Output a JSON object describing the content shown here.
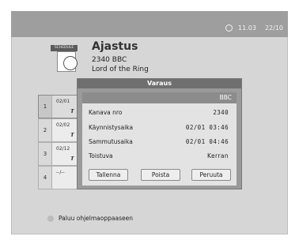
{
  "header": {
    "clock_time": "11.03",
    "clock_date": "22/10",
    "clock_icon": "clock-icon",
    "schedule_tag": "SCHEDULE"
  },
  "program": {
    "title": "Ajastus",
    "line1": "2340  BBC",
    "line2": "Lord of the Ring"
  },
  "list": {
    "rows": [
      {
        "num": "1",
        "date": "02/01",
        "icon": "antenna-icon"
      },
      {
        "num": "2",
        "date": "02/02",
        "icon": "antenna-icon"
      },
      {
        "num": "3",
        "date": "02/12",
        "icon": "antenna-icon"
      },
      {
        "num": "4",
        "date": "--/--",
        "icon": ""
      }
    ]
  },
  "dialog": {
    "title": "Varaus",
    "channel_name": "BBC",
    "fields": [
      {
        "label": "Kanava nro",
        "value": "2340"
      },
      {
        "label": "Käynnistysaika",
        "value": "02/01  03:46"
      },
      {
        "label": "Sammutusaika",
        "value": "02/01  04:46"
      },
      {
        "label": "Toistuva",
        "value": "Kerran"
      }
    ],
    "buttons": {
      "save": "Tallenna",
      "delete": "Poista",
      "cancel": "Peruuta"
    }
  },
  "help": {
    "back": "Paluu ohjelmaoppaaseen"
  },
  "colors": {
    "frame": "#d6d6d6",
    "topbar": "#9e9e9e",
    "dialog": "#9a9a9a"
  }
}
